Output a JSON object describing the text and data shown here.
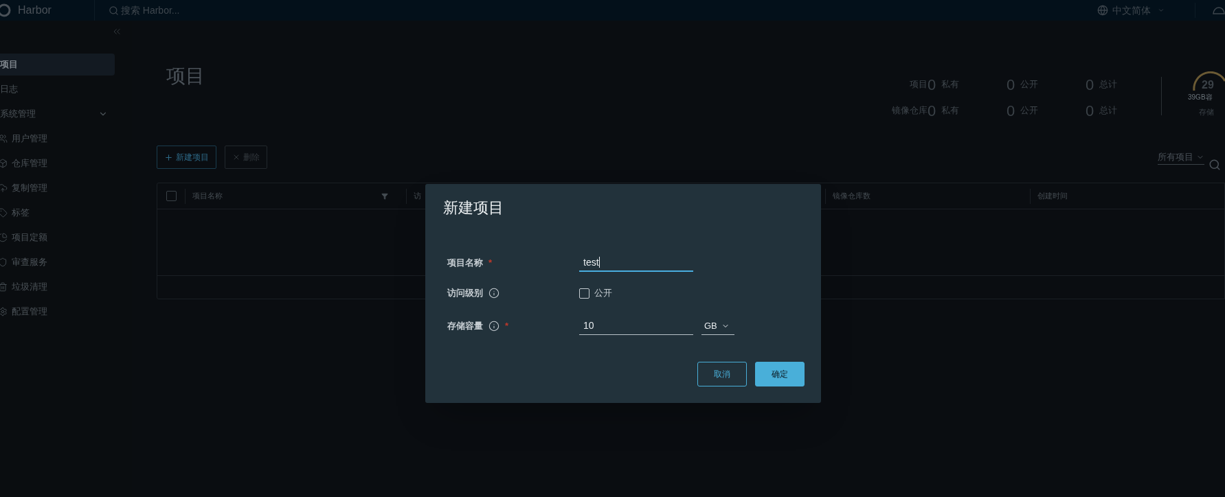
{
  "header": {
    "logo_text": "Harbor",
    "search_placeholder": "搜索 Harbor...",
    "language": "中文简体"
  },
  "sidebar": {
    "items": [
      {
        "label": "项目",
        "selected": true
      },
      {
        "label": "日志",
        "selected": false
      },
      {
        "label": "系统管理",
        "selected": false,
        "expanded": true,
        "children": [
          {
            "label": "用户管理",
            "selected": false
          },
          {
            "label": "仓库管理",
            "selected": false
          },
          {
            "label": "复制管理",
            "selected": false
          },
          {
            "label": "标签",
            "selected": false
          },
          {
            "label": "项目定额",
            "selected": false
          },
          {
            "label": "审查服务",
            "selected": false
          },
          {
            "label": "垃圾清理",
            "selected": false
          },
          {
            "label": "配置管理",
            "selected": false
          }
        ]
      }
    ]
  },
  "page": {
    "title": "项目",
    "stats": [
      {
        "label": "项目",
        "cells": [
          {
            "value": "0",
            "label": "私有"
          },
          {
            "value": "0",
            "label": "公开"
          },
          {
            "value": "0",
            "label": "总计"
          }
        ]
      },
      {
        "label": "镜像仓库",
        "cells": [
          {
            "value": "0",
            "label": "私有"
          },
          {
            "value": "0",
            "label": "公开"
          },
          {
            "value": "0",
            "label": "总计"
          }
        ]
      }
    ],
    "storage": {
      "value": "29",
      "caption": "39GB容",
      "label": "存储"
    }
  },
  "toolbar": {
    "buttons": [
      {
        "kind": "add",
        "label": "新建项目",
        "disabled": false
      },
      {
        "kind": "delete",
        "label": "删除",
        "disabled": true
      }
    ],
    "filter": {
      "value": "所有项目"
    }
  },
  "table": {
    "select_all_checked": false,
    "columns": [
      {
        "label": "项目名称",
        "filter": true
      },
      {
        "label": "访",
        "filter": false
      },
      {
        "label": "镜像仓库数",
        "filter": false
      },
      {
        "label": "创建时间",
        "filter": false
      }
    ]
  },
  "dialog": {
    "title": "新建项目",
    "fields": [
      {
        "kind": "text",
        "label": "项目名称",
        "info": false,
        "required_mark": "*",
        "value": "test",
        "focused": true
      },
      {
        "kind": "checkbox",
        "label": "访问级别",
        "info": true,
        "option": "公开",
        "checked": false
      },
      {
        "kind": "quota",
        "label": "存储容量",
        "info": true,
        "required_mark": "*",
        "value": "10",
        "unit": "GB"
      }
    ],
    "buttons": [
      {
        "label": "取消",
        "primary": false
      },
      {
        "label": "确定",
        "primary": true
      }
    ]
  }
}
